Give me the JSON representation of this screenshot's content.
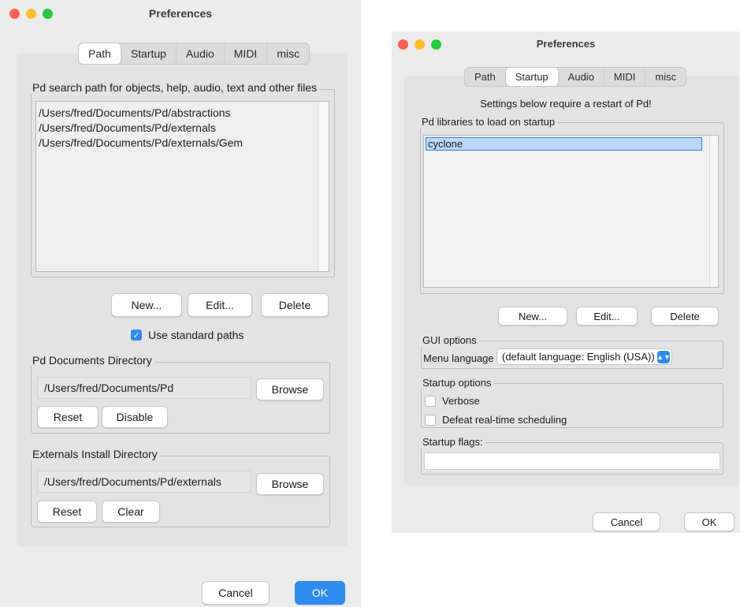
{
  "left_window": {
    "title": "Preferences",
    "tabs": [
      "Path",
      "Startup",
      "Audio",
      "MIDI",
      "misc"
    ],
    "search_path": {
      "legend": "Pd search path for objects, help, audio, text and other files",
      "items": [
        "/Users/fred/Documents/Pd/abstractions",
        "/Users/fred/Documents/Pd/externals",
        "/Users/fred/Documents/Pd/externals/Gem"
      ]
    },
    "buttons": {
      "new": "New...",
      "edit": "Edit...",
      "delete": "Delete"
    },
    "use_standard_paths": {
      "label": "Use standard paths",
      "checked": true
    },
    "documents_dir": {
      "legend": "Pd Documents Directory",
      "value": "/Users/fred/Documents/Pd",
      "browse": "Browse",
      "reset": "Reset",
      "disable": "Disable"
    },
    "externals_dir": {
      "legend": "Externals Install Directory",
      "value": "/Users/fred/Documents/Pd/externals",
      "browse": "Browse",
      "reset": "Reset",
      "clear": "Clear"
    },
    "cancel": "Cancel",
    "ok": "OK"
  },
  "right_window": {
    "title": "Preferences",
    "tabs": [
      "Path",
      "Startup",
      "Audio",
      "MIDI",
      "misc"
    ],
    "restart_notice": "Settings below require a restart of Pd!",
    "libraries": {
      "legend": "Pd libraries to load on startup",
      "items": [
        "cyclone"
      ]
    },
    "buttons": {
      "new": "New...",
      "edit": "Edit...",
      "delete": "Delete"
    },
    "gui_options": {
      "legend": "GUI options",
      "menu_language_label": "Menu language",
      "menu_language_value": "(default language: English (USA))"
    },
    "startup_options": {
      "legend": "Startup options",
      "verbose": "Verbose",
      "defeat_rt": "Defeat real-time scheduling"
    },
    "startup_flags": {
      "legend": "Startup flags:",
      "value": ""
    },
    "cancel": "Cancel",
    "ok": "OK"
  },
  "colors": {
    "accent": "#2f8bf0",
    "window_bg": "#ececec",
    "panel_bg": "#e3e3e3"
  },
  "icons": {
    "check": "checkmark-icon",
    "select_arrows": "chevron-up-down-icon"
  }
}
